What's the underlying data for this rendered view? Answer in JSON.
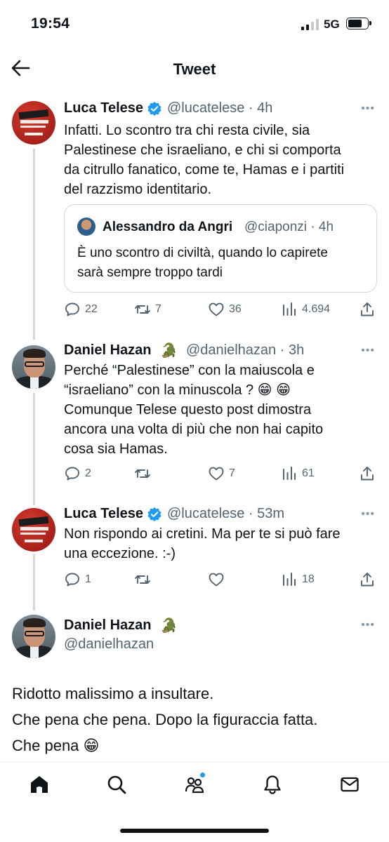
{
  "status_bar": {
    "time": "19:54",
    "network": "5G"
  },
  "header": {
    "title": "Tweet"
  },
  "tweets": [
    {
      "name": "Luca Telese",
      "handle_time": "@lucatelese · 4h",
      "text": "Infatti. Lo scontro tra chi resta civile, sia\nPalestinese che israeliano, e chi si comporta\nda citrullo fanatico, come te, Hamas e i partiti\ndel razzismo identitario.",
      "quote": {
        "name": "Alessandro da Angri",
        "handle_time": "@ciaponzi · 4h",
        "text": "È uno scontro di civiltà, quando lo capirete\nsarà sempre troppo tardi"
      },
      "replies": "22",
      "retweets": "7",
      "likes": "36",
      "views": "4.694"
    },
    {
      "name": "Daniel Hazan",
      "emoji": "🐊",
      "handle_time": "@danielhazan · 3h",
      "text": "Perché “Palestinese” con la maiuscola e\n“israeliano” con la minuscola ? 😁 😁\nComunque Telese questo post dimostra\nancora una volta di più che non hai capito\ncosa sia Hamas.",
      "replies": "2",
      "retweets": "",
      "likes": "7",
      "views": "61"
    },
    {
      "name": "Luca Telese",
      "handle_time": "@lucatelese · 53m",
      "text": "Non rispondo ai cretini. Ma per te si può fare\nuna eccezione. :-)",
      "replies": "1",
      "retweets": "",
      "likes": "",
      "views": "18"
    }
  ],
  "main_tweet": {
    "name": "Daniel Hazan",
    "emoji": "🐊",
    "handle": "@danielhazan",
    "text": "Ridotto malissimo a insultare.\nChe pena che pena. Dopo la figuraccia fatta.\nChe pena 😁"
  },
  "avatar_book_text": "LUCA TELESE",
  "more_glyph": "•••",
  "colors": {
    "accent": "#1d9bf0",
    "muted": "#536471",
    "line": "#cfd9de"
  }
}
